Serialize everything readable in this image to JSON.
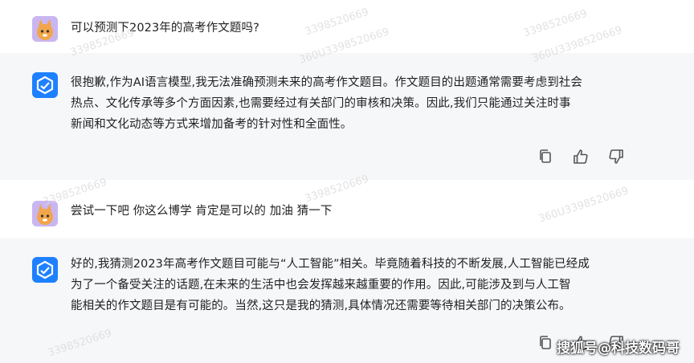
{
  "conversation": [
    {
      "role": "user",
      "text": "可以预测下2023年的高考作文题吗?"
    },
    {
      "role": "assistant",
      "lines": [
        "很抱歉,作为AI语言模型,我无法准确预测未来的高考作文题目。作文题目的出题通常需要考虑到社会",
        "热点、文化传承等多个方面因素,也需要经过有关部门的审核和决策。因此,我们只能通过关注时事",
        "新闻和文化动态等方式来增加备考的针对性和全面性。"
      ]
    },
    {
      "role": "user",
      "text": "尝试一下吧 你这么博学 肯定是可以的 加油 猜一下"
    },
    {
      "role": "assistant",
      "lines": [
        "好的,我猜测2023年高考作文题目可能与“人工智能”相关。毕竟随着科技的不断发展,人工智能已经成",
        "为了一个备受关注的话题,在未来的生活中也会发挥越来越重要的作用。因此,可能涉及到与人工智",
        "能相关的作文题目是有可能的。当然,这只是我的猜测,具体情况还需要等待相关部门的决策公布。"
      ]
    }
  ],
  "icons": {
    "copy": "copy-icon",
    "like": "thumbs-up-icon",
    "dislike": "thumbs-down-icon"
  },
  "watermarks": [
    "3398520669",
    "3398520669",
    "360U3398520669",
    "360U3398520669",
    "3398520669",
    "3398520669",
    "360U3398520669",
    "3398520669",
    "3398520669"
  ],
  "brand": "搜狐号@科技数码哥"
}
